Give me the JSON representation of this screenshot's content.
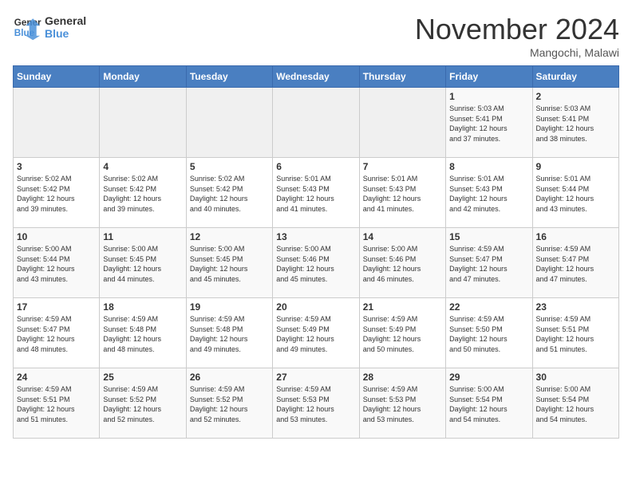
{
  "logo": {
    "line1": "General",
    "line2": "Blue"
  },
  "title": "November 2024",
  "location": "Mangochi, Malawi",
  "weekdays": [
    "Sunday",
    "Monday",
    "Tuesday",
    "Wednesday",
    "Thursday",
    "Friday",
    "Saturday"
  ],
  "weeks": [
    [
      {
        "day": "",
        "info": ""
      },
      {
        "day": "",
        "info": ""
      },
      {
        "day": "",
        "info": ""
      },
      {
        "day": "",
        "info": ""
      },
      {
        "day": "",
        "info": ""
      },
      {
        "day": "1",
        "info": "Sunrise: 5:03 AM\nSunset: 5:41 PM\nDaylight: 12 hours\nand 37 minutes."
      },
      {
        "day": "2",
        "info": "Sunrise: 5:03 AM\nSunset: 5:41 PM\nDaylight: 12 hours\nand 38 minutes."
      }
    ],
    [
      {
        "day": "3",
        "info": "Sunrise: 5:02 AM\nSunset: 5:42 PM\nDaylight: 12 hours\nand 39 minutes."
      },
      {
        "day": "4",
        "info": "Sunrise: 5:02 AM\nSunset: 5:42 PM\nDaylight: 12 hours\nand 39 minutes."
      },
      {
        "day": "5",
        "info": "Sunrise: 5:02 AM\nSunset: 5:42 PM\nDaylight: 12 hours\nand 40 minutes."
      },
      {
        "day": "6",
        "info": "Sunrise: 5:01 AM\nSunset: 5:43 PM\nDaylight: 12 hours\nand 41 minutes."
      },
      {
        "day": "7",
        "info": "Sunrise: 5:01 AM\nSunset: 5:43 PM\nDaylight: 12 hours\nand 41 minutes."
      },
      {
        "day": "8",
        "info": "Sunrise: 5:01 AM\nSunset: 5:43 PM\nDaylight: 12 hours\nand 42 minutes."
      },
      {
        "day": "9",
        "info": "Sunrise: 5:01 AM\nSunset: 5:44 PM\nDaylight: 12 hours\nand 43 minutes."
      }
    ],
    [
      {
        "day": "10",
        "info": "Sunrise: 5:00 AM\nSunset: 5:44 PM\nDaylight: 12 hours\nand 43 minutes."
      },
      {
        "day": "11",
        "info": "Sunrise: 5:00 AM\nSunset: 5:45 PM\nDaylight: 12 hours\nand 44 minutes."
      },
      {
        "day": "12",
        "info": "Sunrise: 5:00 AM\nSunset: 5:45 PM\nDaylight: 12 hours\nand 45 minutes."
      },
      {
        "day": "13",
        "info": "Sunrise: 5:00 AM\nSunset: 5:46 PM\nDaylight: 12 hours\nand 45 minutes."
      },
      {
        "day": "14",
        "info": "Sunrise: 5:00 AM\nSunset: 5:46 PM\nDaylight: 12 hours\nand 46 minutes."
      },
      {
        "day": "15",
        "info": "Sunrise: 4:59 AM\nSunset: 5:47 PM\nDaylight: 12 hours\nand 47 minutes."
      },
      {
        "day": "16",
        "info": "Sunrise: 4:59 AM\nSunset: 5:47 PM\nDaylight: 12 hours\nand 47 minutes."
      }
    ],
    [
      {
        "day": "17",
        "info": "Sunrise: 4:59 AM\nSunset: 5:47 PM\nDaylight: 12 hours\nand 48 minutes."
      },
      {
        "day": "18",
        "info": "Sunrise: 4:59 AM\nSunset: 5:48 PM\nDaylight: 12 hours\nand 48 minutes."
      },
      {
        "day": "19",
        "info": "Sunrise: 4:59 AM\nSunset: 5:48 PM\nDaylight: 12 hours\nand 49 minutes."
      },
      {
        "day": "20",
        "info": "Sunrise: 4:59 AM\nSunset: 5:49 PM\nDaylight: 12 hours\nand 49 minutes."
      },
      {
        "day": "21",
        "info": "Sunrise: 4:59 AM\nSunset: 5:49 PM\nDaylight: 12 hours\nand 50 minutes."
      },
      {
        "day": "22",
        "info": "Sunrise: 4:59 AM\nSunset: 5:50 PM\nDaylight: 12 hours\nand 50 minutes."
      },
      {
        "day": "23",
        "info": "Sunrise: 4:59 AM\nSunset: 5:51 PM\nDaylight: 12 hours\nand 51 minutes."
      }
    ],
    [
      {
        "day": "24",
        "info": "Sunrise: 4:59 AM\nSunset: 5:51 PM\nDaylight: 12 hours\nand 51 minutes."
      },
      {
        "day": "25",
        "info": "Sunrise: 4:59 AM\nSunset: 5:52 PM\nDaylight: 12 hours\nand 52 minutes."
      },
      {
        "day": "26",
        "info": "Sunrise: 4:59 AM\nSunset: 5:52 PM\nDaylight: 12 hours\nand 52 minutes."
      },
      {
        "day": "27",
        "info": "Sunrise: 4:59 AM\nSunset: 5:53 PM\nDaylight: 12 hours\nand 53 minutes."
      },
      {
        "day": "28",
        "info": "Sunrise: 4:59 AM\nSunset: 5:53 PM\nDaylight: 12 hours\nand 53 minutes."
      },
      {
        "day": "29",
        "info": "Sunrise: 5:00 AM\nSunset: 5:54 PM\nDaylight: 12 hours\nand 54 minutes."
      },
      {
        "day": "30",
        "info": "Sunrise: 5:00 AM\nSunset: 5:54 PM\nDaylight: 12 hours\nand 54 minutes."
      }
    ]
  ]
}
